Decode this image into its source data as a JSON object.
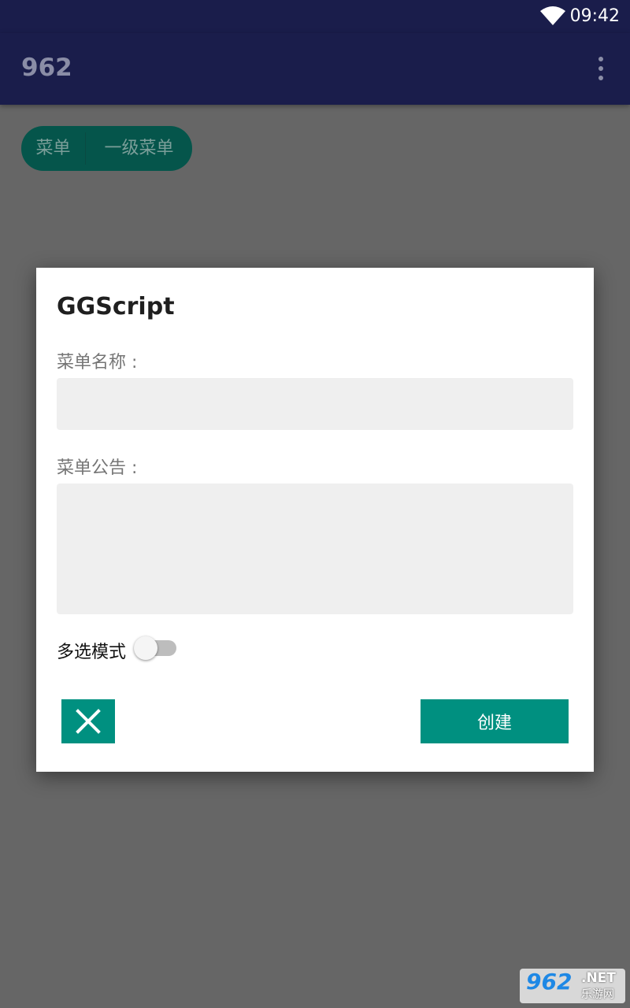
{
  "status_bar": {
    "time": "09:42"
  },
  "app_bar": {
    "title": "962"
  },
  "tabs": [
    {
      "label": "菜单"
    },
    {
      "label": "一级菜单"
    }
  ],
  "dialog": {
    "title": "GGScript",
    "menu_name_label": "菜单名称 :",
    "menu_name_value": "",
    "menu_notice_label": "菜单公告 :",
    "menu_notice_value": "",
    "multi_select_label": "多选模式",
    "multi_select_on": false,
    "create_label": "创建"
  },
  "watermark": {
    "number": "962",
    "suffix": ".NET",
    "site_name": "乐游网"
  },
  "colors": {
    "app_bar": "#1a1d4b",
    "accent": "#009080",
    "chip": "#05554b",
    "scrim": "#666666"
  }
}
